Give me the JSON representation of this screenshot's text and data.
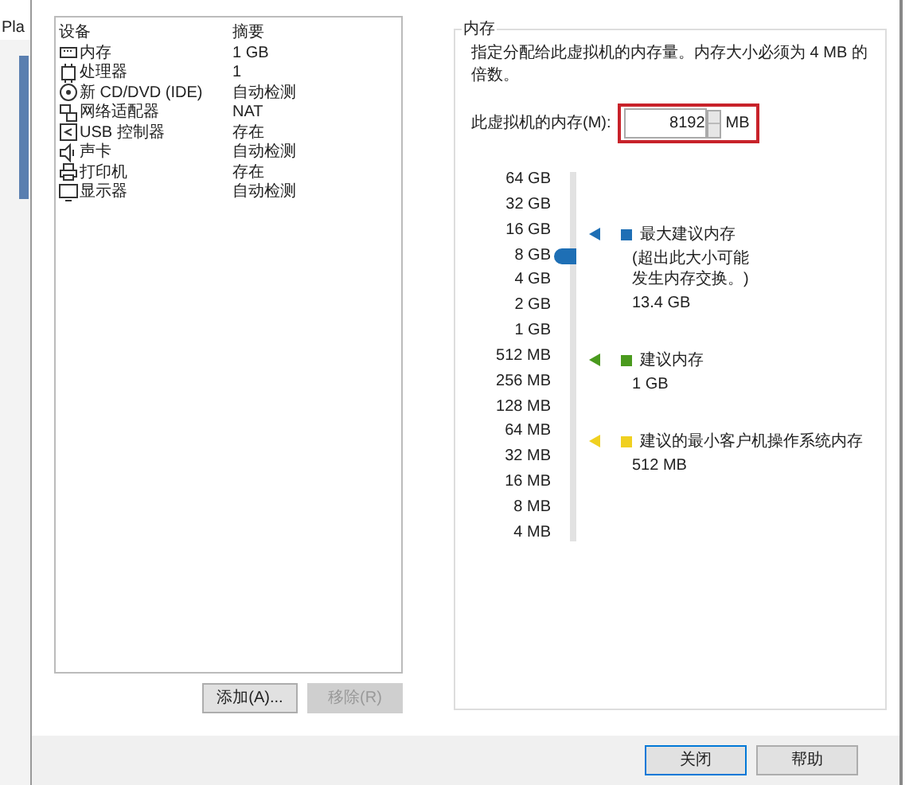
{
  "background_tab": {
    "label": "Pla"
  },
  "devices": {
    "columns": [
      "设备",
      "摘要"
    ],
    "rows": [
      {
        "kind": "memory",
        "device": "内存",
        "summary": "1 GB",
        "selected": false
      },
      {
        "kind": "cpu",
        "device": "处理器",
        "summary": "1",
        "selected": false
      },
      {
        "kind": "disc",
        "device": "新 CD/DVD (IDE)",
        "summary": "自动检测",
        "selected": false
      },
      {
        "kind": "network",
        "device": "网络适配器",
        "summary": "NAT",
        "selected": false
      },
      {
        "kind": "usb",
        "device": "USB 控制器",
        "summary": "存在",
        "selected": false
      },
      {
        "kind": "sound",
        "device": "声卡",
        "summary": "自动检测",
        "selected": false
      },
      {
        "kind": "printer",
        "device": "打印机",
        "summary": "存在",
        "selected": false
      },
      {
        "kind": "display",
        "device": "显示器",
        "summary": "自动检测",
        "selected": false
      }
    ],
    "buttons": [
      {
        "label": "添加(A)...",
        "disabled": false
      },
      {
        "label": "移除(R)",
        "disabled": true
      }
    ]
  },
  "memory": {
    "title": "内存",
    "description": "指定分配给此虚拟机的内存量。内存大小必须为 4 MB 的倍数。",
    "field_label": "此虚拟机的内存(M):",
    "value": "8192",
    "unit": "MB",
    "scale": [
      "64 GB",
      "32 GB",
      "16 GB",
      "8 GB",
      "4 GB",
      "2 GB",
      "1 GB",
      "512 MB",
      "256 MB",
      "128 MB",
      "64 MB",
      "32 MB",
      "16 MB",
      "8 MB",
      "4 MB"
    ],
    "slider": {
      "level": 0.786
    },
    "legend": [
      {
        "label": "最大建议内存",
        "note": "(超出此大小可能发生内存交换。)",
        "value": "13.4 GB",
        "color": "#1e6fb5"
      },
      {
        "label": "建议内存",
        "value": "1 GB",
        "color": "#4a9a1e"
      },
      {
        "label": "建议的最小客户机操作系统内存",
        "value": "512 MB",
        "color": "#f0d020"
      }
    ]
  },
  "footer_buttons": [
    {
      "label": "关闭"
    },
    {
      "label": "帮助"
    }
  ]
}
